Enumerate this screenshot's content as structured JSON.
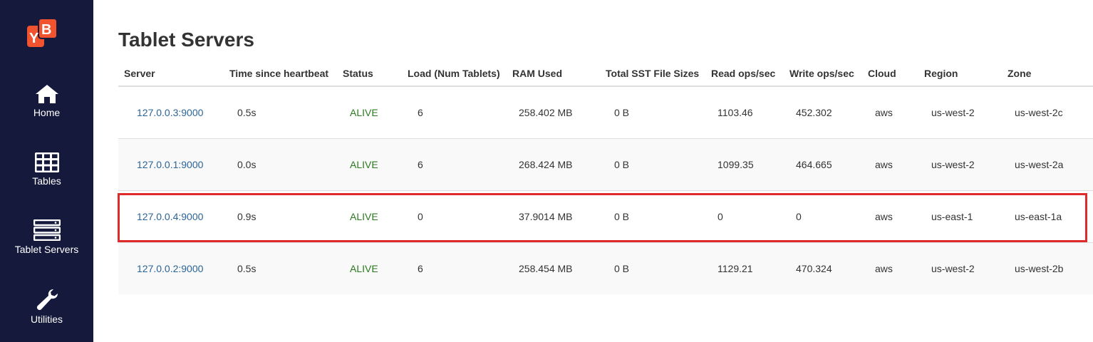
{
  "app": {
    "logo_text": "YB"
  },
  "sidebar": {
    "items": [
      {
        "label": "Home",
        "icon": "home-icon"
      },
      {
        "label": "Tables",
        "icon": "table-icon"
      },
      {
        "label": "Tablet Servers",
        "icon": "server-icon"
      },
      {
        "label": "Utilities",
        "icon": "wrench-icon"
      }
    ]
  },
  "page": {
    "title": "Tablet Servers"
  },
  "table": {
    "headers": [
      "Server",
      "Time since heartbeat",
      "Status",
      "Load (Num Tablets)",
      "RAM Used",
      "Total SST File Sizes",
      "Read ops/sec",
      "Write ops/sec",
      "Cloud",
      "Region",
      "Zone"
    ],
    "rows": [
      [
        "127.0.0.3:9000",
        "0.5s",
        "ALIVE",
        "6",
        "258.402 MB",
        "0 B",
        "1103.46",
        "452.302",
        "aws",
        "us-west-2",
        "us-west-2c"
      ],
      [
        "127.0.0.1:9000",
        "0.0s",
        "ALIVE",
        "6",
        "268.424 MB",
        "0 B",
        "1099.35",
        "464.665",
        "aws",
        "us-west-2",
        "us-west-2a"
      ],
      [
        "127.0.0.4:9000",
        "0.9s",
        "ALIVE",
        "0",
        "37.9014 MB",
        "0 B",
        "0",
        "0",
        "aws",
        "us-east-1",
        "us-east-1a"
      ],
      [
        "127.0.0.2:9000",
        "0.5s",
        "ALIVE",
        "6",
        "258.454 MB",
        "0 B",
        "1129.21",
        "470.324",
        "aws",
        "us-west-2",
        "us-west-2b"
      ]
    ]
  },
  "colors": {
    "sidebar_bg": "#151a3d",
    "logo": "#f0532e",
    "link": "#2a6496",
    "alive": "#2a7a1e",
    "highlight": "#e02b2b"
  }
}
